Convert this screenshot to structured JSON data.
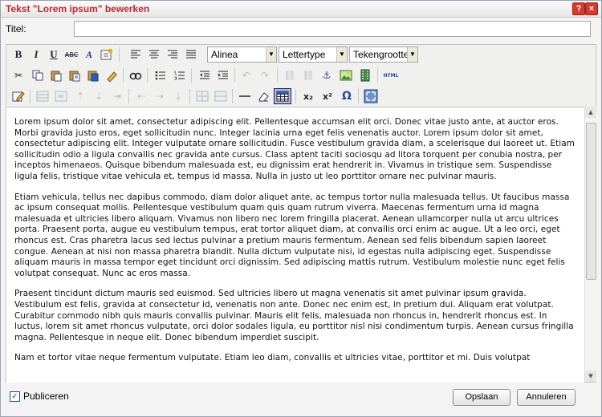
{
  "dialog": {
    "title": "Tekst \"Lorem ipsum\" bewerken",
    "help_label": "?",
    "close_label": "×"
  },
  "form": {
    "title_label": "Titel:",
    "title_value": ""
  },
  "toolbar": {
    "format_select": "Alinea",
    "font_select": "Lettertype",
    "size_select": "Tekengrootte",
    "html_label": "HTML"
  },
  "content": {
    "paragraphs": [
      "Lorem ipsum dolor sit amet, consectetur adipiscing elit. Pellentesque accumsan elit orci. Donec vitae justo ante, at auctor eros. Morbi gravida justo eros, eget sollicitudin nunc. Integer lacinia urna eget felis venenatis auctor. Lorem ipsum dolor sit amet, consectetur adipiscing elit. Integer vulputate ornare sollicitudin. Fusce vestibulum gravida diam, a scelerisque dui laoreet ut. Etiam sollicitudin odio a ligula convallis nec gravida ante cursus. Class aptent taciti sociosqu ad litora torquent per conubia nostra, per inceptos himenaeos. Quisque bibendum malesuada est, eu dignissim erat hendrerit in. Vivamus in tristique sem. Suspendisse ligula felis, tristique vitae vehicula et, tempus id massa. Nulla in justo ut leo porttitor ornare nec pulvinar mauris.",
      "Etiam vehicula, tellus nec dapibus commodo, diam dolor aliquet ante, ac tempus tortor nulla malesuada tellus. Ut faucibus massa ac ipsum consequat mollis. Pellentesque vestibulum quam quis quam rutrum viverra. Maecenas fermentum urna id magna malesuada et ultricies libero aliquam. Vivamus non libero nec lorem fringilla placerat. Aenean ullamcorper nulla ut arcu ultrices porta. Praesent porta, augue eu vestibulum tempus, erat tortor aliquet diam, at convallis orci enim ac augue. Ut a leo orci, eget rhoncus est. Cras pharetra lacus sed lectus pulvinar a pretium mauris fermentum. Aenean sed felis bibendum sapien laoreet congue. Aenean at nisi non massa pharetra blandit. Nulla dictum vulputate nisi, id egestas nulla adipiscing eget. Suspendisse aliquam mauris in massa tempor eget tincidunt orci dignissim. Sed adipiscing mattis rutrum. Vestibulum molestie nunc eget felis volutpat consequat. Nunc ac eros massa.",
      "Praesent tincidunt dictum mauris sed euismod. Sed ultricies libero ut magna venenatis sit amet pulvinar ipsum gravida. Vestibulum est felis, gravida at consectetur id, venenatis non ante. Donec nec enim est, in pretium dui. Aliquam erat volutpat. Curabitur commodo nibh quis mauris convallis pulvinar. Mauris elit felis, malesuada non rhoncus in, hendrerit rhoncus est. In luctus, lorem sit amet rhoncus vulputate, orci dolor sodales ligula, eu porttitor nisl nisi condimentum turpis. Aenean cursus fringilla magna. Pellentesque in neque elit. Donec bibendum imperdiet suscipit.",
      "Nam et tortor vitae neque fermentum vulputate. Etiam leo diam, convallis et ultricies vitae, porttitor et mi. Duis volutpat"
    ]
  },
  "footer": {
    "publish_label": "Publiceren",
    "publish_checked": true,
    "save_label": "Opslaan",
    "cancel_label": "Annuleren"
  }
}
